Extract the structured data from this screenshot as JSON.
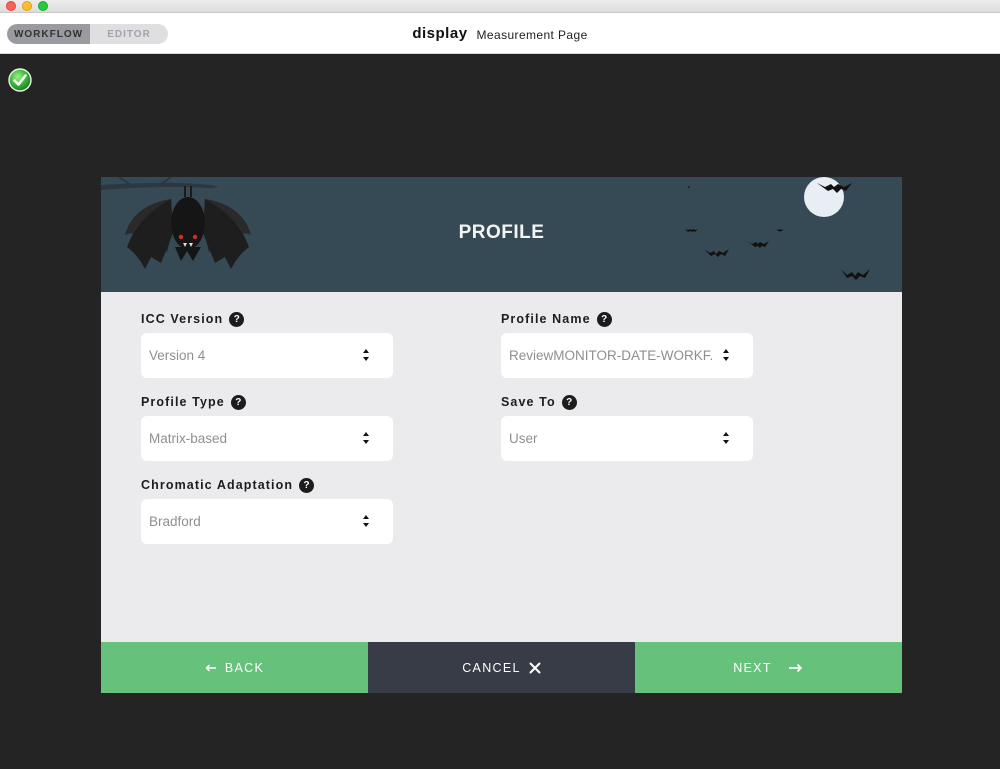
{
  "header": {
    "modes": [
      {
        "label": "WORKFLOW",
        "active": true
      },
      {
        "label": "EDITOR",
        "active": false
      }
    ],
    "app_name": "display",
    "page_name": "Measurement Page"
  },
  "status": {
    "icon": "check-circle-icon",
    "color": "#3cba3c"
  },
  "profile": {
    "title": "PROFILE",
    "fields": {
      "icc_version": {
        "label": "ICC Version",
        "value": "Version 4"
      },
      "profile_name": {
        "label": "Profile Name",
        "value": "ReviewMONITOR-DATE-WORKF..."
      },
      "profile_type": {
        "label": "Profile Type",
        "value": "Matrix-based"
      },
      "save_to": {
        "label": "Save To",
        "value": "User"
      },
      "chromatic_adaptation": {
        "label": "Chromatic Adaptation",
        "value": "Bradford"
      }
    },
    "help_glyph": "?"
  },
  "footer": {
    "back_label": "BACK",
    "cancel_label": "CANCEL",
    "next_label": "NEXT"
  },
  "colors": {
    "accent_green": "#66c27b",
    "cancel_dark": "#373c47",
    "banner": "#364a56",
    "panel": "#ebebed",
    "background": "#242424"
  }
}
